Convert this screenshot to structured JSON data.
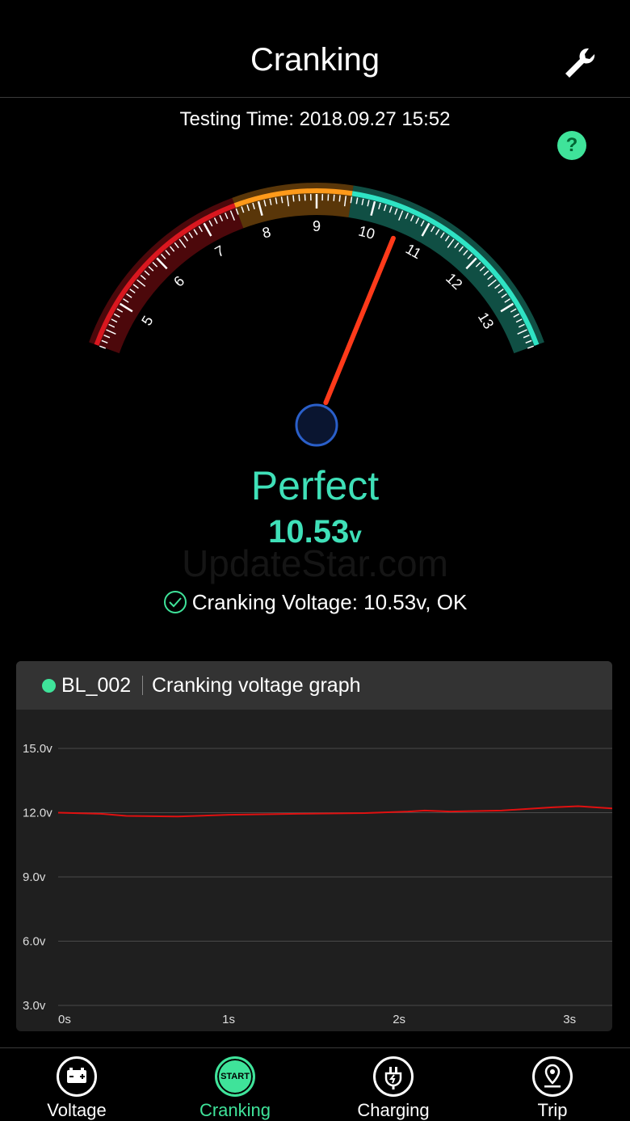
{
  "header": {
    "title": "Cranking",
    "settings_icon": "wrench-icon"
  },
  "testing_time": {
    "label": "Testing Time:",
    "date": "2018.09.27",
    "time": "15:52",
    "text": "Testing Time: 2018.09.27  15:52"
  },
  "help": {
    "label": "?",
    "icon": "help-icon"
  },
  "gauge": {
    "ticks": [
      "5",
      "6",
      "7",
      "8",
      "9",
      "10",
      "11",
      "12",
      "13"
    ],
    "value": 10.53,
    "range": [
      4.2,
      13.8
    ],
    "zones": [
      {
        "from": 4.2,
        "to": 7.6,
        "color": "#d9171f"
      },
      {
        "from": 7.6,
        "to": 9.6,
        "color": "#ff9a1a"
      },
      {
        "from": 9.6,
        "to": 13.8,
        "color": "#2fe3c4"
      }
    ]
  },
  "result": {
    "status": "Perfect",
    "value": "10.53",
    "unit": "v",
    "verdict": "Cranking Voltage: 10.53v, OK"
  },
  "watermark": "UpdateStar.com",
  "graph": {
    "device": "BL_002",
    "title": "Cranking voltage graph",
    "y_labels": [
      "15.0v",
      "12.0v",
      "9.0v",
      "6.0v",
      "3.0v"
    ],
    "x_labels": [
      "0s",
      "1s",
      "2s",
      "3s"
    ],
    "series": {
      "name": "",
      "x": [
        0,
        0.25,
        0.4,
        0.7,
        1.0,
        1.4,
        1.8,
        2.05,
        2.15,
        2.3,
        2.6,
        2.9,
        3.05,
        3.25
      ],
      "y": [
        12.0,
        11.95,
        11.85,
        11.82,
        11.9,
        11.95,
        11.98,
        12.05,
        12.1,
        12.05,
        12.1,
        12.25,
        12.3,
        12.2
      ]
    },
    "ylim": [
      3.0,
      15.0
    ],
    "xlim": [
      0,
      3.25
    ],
    "line_color": "#e01010"
  },
  "tabs": [
    {
      "label": "Voltage",
      "icon": "battery-icon",
      "active": false
    },
    {
      "label": "Cranking",
      "icon": "start-icon",
      "icon_text": "START",
      "active": true
    },
    {
      "label": "Charging",
      "icon": "plug-icon",
      "active": false
    },
    {
      "label": "Trip",
      "icon": "location-pin-icon",
      "active": false
    }
  ],
  "colors": {
    "accent": "#3fe39a",
    "value": "#3fe0b8",
    "needle": "#ff3a1a"
  }
}
